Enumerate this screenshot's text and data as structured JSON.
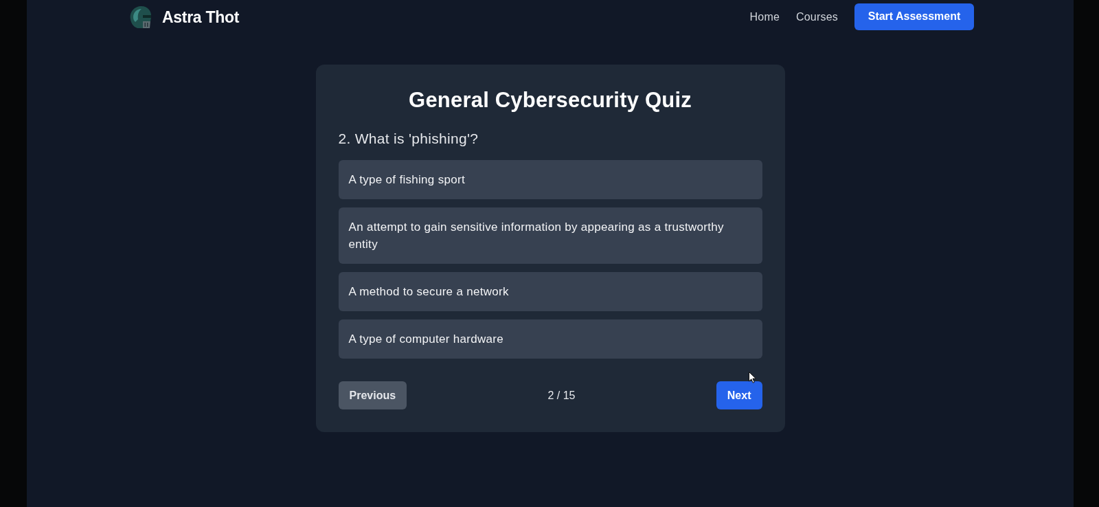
{
  "header": {
    "brand": "Astra Thot",
    "nav": [
      {
        "label": "Home"
      },
      {
        "label": "Courses"
      }
    ],
    "cta": "Start Assessment"
  },
  "quiz": {
    "title": "General Cybersecurity Quiz",
    "question": "2. What is 'phishing'?",
    "options": [
      {
        "text": "A type of fishing sport",
        "selected": false
      },
      {
        "text": "An attempt to gain sensitive information by appearing as a trustworthy entity",
        "selected": false
      },
      {
        "text": "A method to secure a network",
        "selected": false
      },
      {
        "text": "A type of computer hardware",
        "selected": false
      }
    ],
    "progress": "2 / 15",
    "previous": "Previous",
    "next": "Next"
  }
}
